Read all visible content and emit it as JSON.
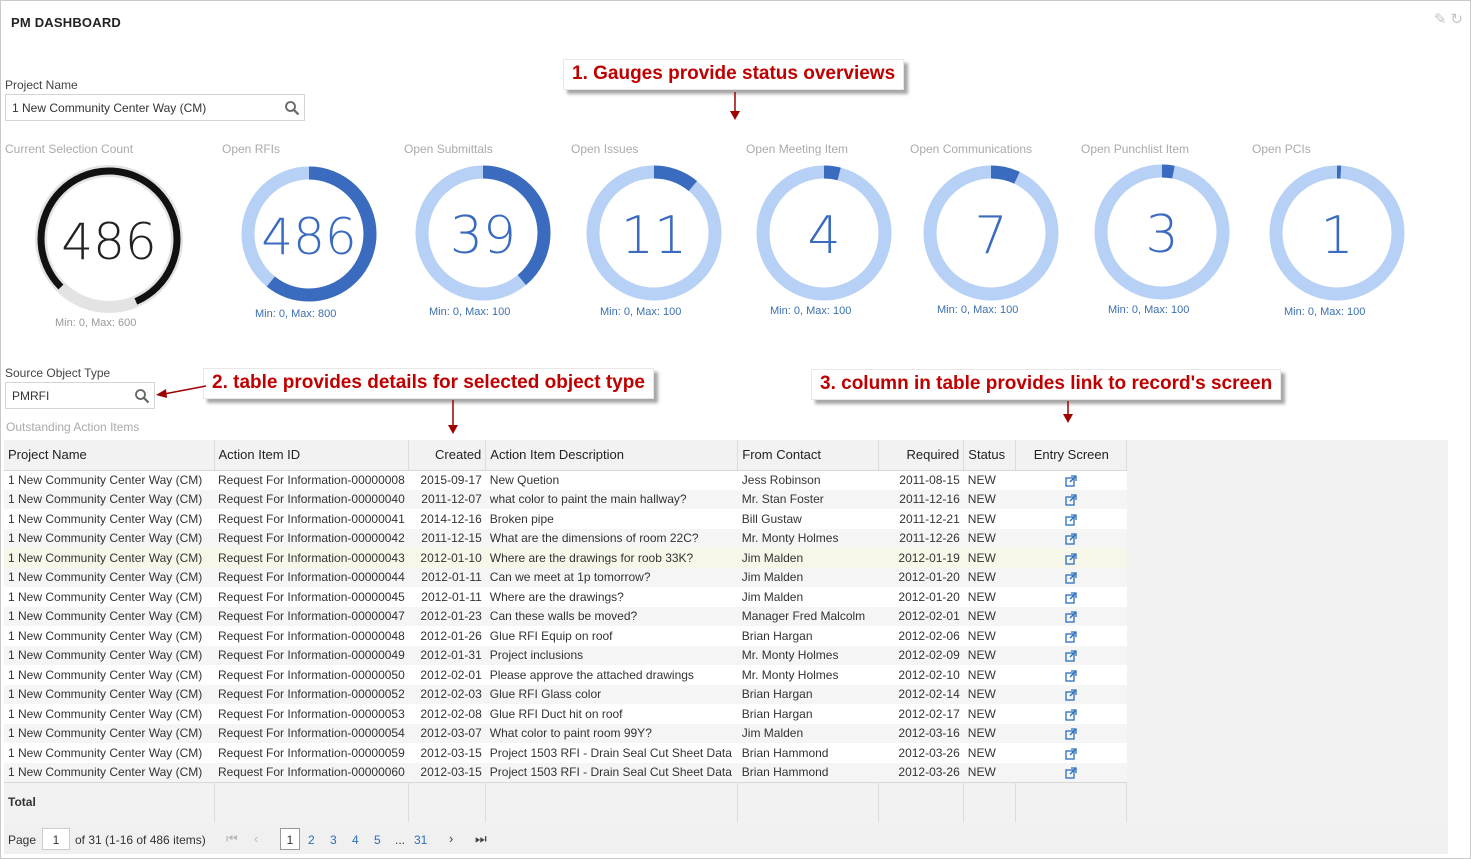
{
  "header": {
    "title": "PM DASHBOARD",
    "icons": [
      "edit-icon",
      "refresh-icon"
    ]
  },
  "project_field": {
    "label": "Project Name",
    "value": "1 New Community Center Way (CM)"
  },
  "source_field": {
    "label": "Source Object Type",
    "value": "PMRFI"
  },
  "gauges": [
    {
      "title": "Current Selection Count",
      "value": "486",
      "range": "Min: 0, Max: 600",
      "fraction": 0.81
    },
    {
      "title": "Open RFIs",
      "value": "486",
      "range": "Min: 0, Max: 800",
      "fraction": 0.6075
    },
    {
      "title": "Open Submittals",
      "value": "39",
      "range": "Min: 0, Max: 100",
      "fraction": 0.39
    },
    {
      "title": "Open Issues",
      "value": "11",
      "range": "Min: 0, Max: 100",
      "fraction": 0.11
    },
    {
      "title": "Open Meeting Item",
      "value": "4",
      "range": "Min: 0, Max: 100",
      "fraction": 0.04
    },
    {
      "title": "Open Communications",
      "value": "7",
      "range": "Min: 0, Max: 100",
      "fraction": 0.07
    },
    {
      "title": "Open Punchlist Item",
      "value": "3",
      "range": "Min: 0, Max: 100",
      "fraction": 0.03
    },
    {
      "title": "Open PCIs",
      "value": "1",
      "range": "Min: 0, Max: 100",
      "fraction": 0.01
    }
  ],
  "callouts": {
    "gauges": "1. Gauges provide status overviews",
    "table": "2. table provides details for selected object type",
    "column": "3. column in table provides link to record's screen"
  },
  "colors": {
    "gauge_track": "#b7d0f5",
    "gauge_fill": "#3a6bbf",
    "count_track": "#e3e3e3",
    "count_fill": "#111111",
    "callout_text": "#c00000",
    "link": "#2a6ebb"
  },
  "table": {
    "section_label": "Outstanding Action Items",
    "columns": [
      "Project Name",
      "Action Item ID",
      "Created",
      "Action Item Description",
      "From Contact",
      "Required",
      "Status",
      "Entry Screen"
    ],
    "rows": [
      [
        "1 New Community Center Way (CM)",
        "Request For Information-00000008",
        "2015-09-17",
        "New Quetion",
        "Jess Robinson",
        "2011-08-15",
        "NEW"
      ],
      [
        "1 New Community Center Way (CM)",
        "Request For Information-00000040",
        "2011-12-07",
        "what color to paint the main hallway?",
        "Mr. Stan Foster",
        "2011-12-16",
        "NEW"
      ],
      [
        "1 New Community Center Way (CM)",
        "Request For Information-00000041",
        "2014-12-16",
        "Broken pipe",
        "Bill Gustaw",
        "2011-12-21",
        "NEW"
      ],
      [
        "1 New Community Center Way (CM)",
        "Request For Information-00000042",
        "2011-12-15",
        "What are the dimensions of room 22C?",
        "Mr. Monty Holmes",
        "2011-12-26",
        "NEW"
      ],
      [
        "1 New Community Center Way (CM)",
        "Request For Information-00000043",
        "2012-01-10",
        "Where are the drawings for roob 33K?",
        "Jim Malden",
        "2012-01-19",
        "NEW"
      ],
      [
        "1 New Community Center Way (CM)",
        "Request For Information-00000044",
        "2012-01-11",
        "Can we meet at 1p tomorrow?",
        "Jim Malden",
        "2012-01-20",
        "NEW"
      ],
      [
        "1 New Community Center Way (CM)",
        "Request For Information-00000045",
        "2012-01-11",
        "Where are the drawings?",
        "Jim Malden",
        "2012-01-20",
        "NEW"
      ],
      [
        "1 New Community Center Way (CM)",
        "Request For Information-00000047",
        "2012-01-23",
        "Can these walls be moved?",
        "Manager Fred Malcolm",
        "2012-02-01",
        "NEW"
      ],
      [
        "1 New Community Center Way (CM)",
        "Request For Information-00000048",
        "2012-01-26",
        "Glue RFI Equip on roof",
        "Brian Hargan",
        "2012-02-06",
        "NEW"
      ],
      [
        "1 New Community Center Way (CM)",
        "Request For Information-00000049",
        "2012-01-31",
        "Project inclusions",
        "Mr. Monty Holmes",
        "2012-02-09",
        "NEW"
      ],
      [
        "1 New Community Center Way (CM)",
        "Request For Information-00000050",
        "2012-02-01",
        "Please approve the attached drawings",
        "Mr. Monty Holmes",
        "2012-02-10",
        "NEW"
      ],
      [
        "1 New Community Center Way (CM)",
        "Request For Information-00000052",
        "2012-02-03",
        "Glue RFI Glass color",
        "Brian Hargan",
        "2012-02-14",
        "NEW"
      ],
      [
        "1 New Community Center Way (CM)",
        "Request For Information-00000053",
        "2012-02-08",
        "Glue RFI Duct hit on roof",
        "Brian Hargan",
        "2012-02-17",
        "NEW"
      ],
      [
        "1 New Community Center Way (CM)",
        "Request For Information-00000054",
        "2012-03-07",
        "What color to paint room 99Y?",
        "Jim Malden",
        "2012-03-16",
        "NEW"
      ],
      [
        "1 New Community Center Way (CM)",
        "Request For Information-00000059",
        "2012-03-15",
        "Project 1503 RFI - Drain Seal Cut Sheet Data",
        "Brian Hammond",
        "2012-03-26",
        "NEW"
      ],
      [
        "1 New Community Center Way (CM)",
        "Request For Information-00000060",
        "2012-03-15",
        "Project 1503 RFI - Drain Seal Cut Sheet Data",
        "Brian Hammond",
        "2012-03-26",
        "NEW"
      ]
    ],
    "highlight_row": 4,
    "total_label": "Total"
  },
  "pager": {
    "page_label": "Page",
    "page_value": "1",
    "summary": "of 31 (1-16 of 486 items)",
    "pages": [
      "1",
      "2",
      "3",
      "4",
      "5",
      "...",
      "31"
    ],
    "current_page": "1"
  }
}
